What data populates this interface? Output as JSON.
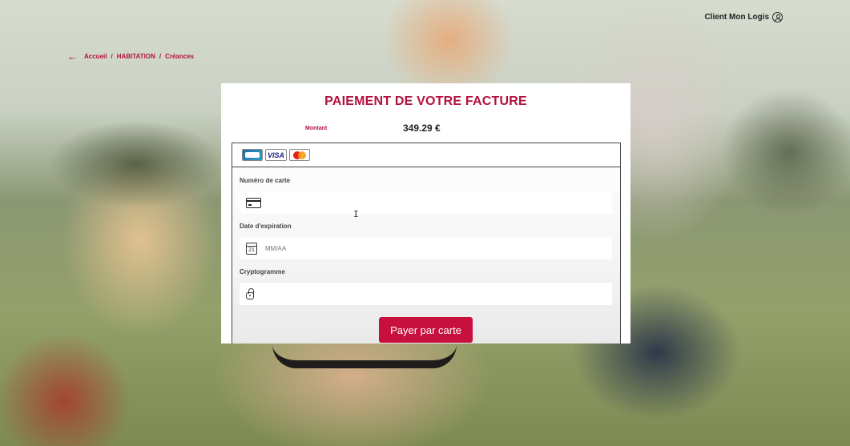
{
  "header": {
    "user_label": "Client Mon Logis"
  },
  "breadcrumb": {
    "items": [
      "Accueil",
      "HABITATION",
      "Créances"
    ],
    "separator": "/"
  },
  "payment": {
    "title": "PAIEMENT DE VOTRE FACTURE",
    "amount_label": "Montant",
    "amount_value": "349.29 €",
    "brands": [
      "cb-card-icon",
      "visa-card-icon",
      "mastercard-icon"
    ],
    "brand_visa_text": "VISA",
    "fields": {
      "card_number": {
        "label": "Numéro de carte",
        "value": "",
        "placeholder": ""
      },
      "expiry": {
        "label": "Date d'expiration",
        "value": "",
        "placeholder": "MM/AA",
        "icon_day": "21"
      },
      "cvv": {
        "label": "Cryptogramme",
        "value": "",
        "placeholder": ""
      }
    },
    "submit_label": "Payer par carte"
  },
  "colors": {
    "accent": "#c8103e",
    "title": "#b3123f"
  }
}
